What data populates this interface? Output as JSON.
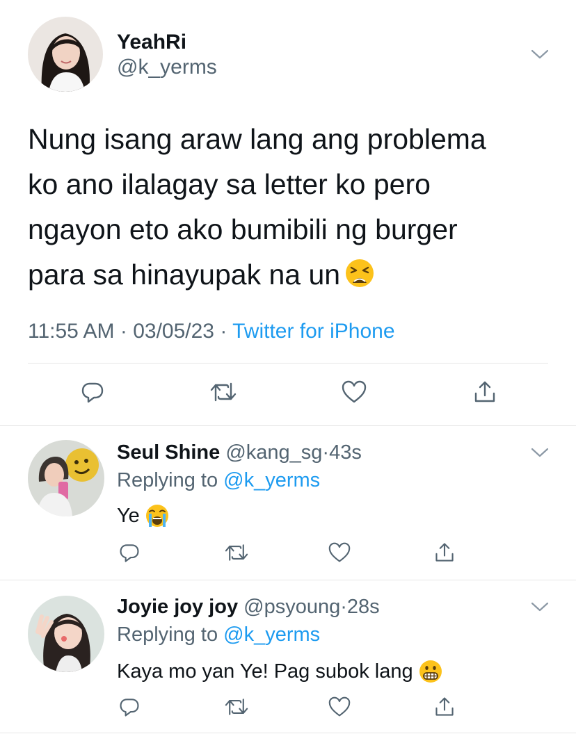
{
  "main_tweet": {
    "display_name": "YeahRi",
    "handle": "@k_yerms",
    "text_lines": [
      "Nung isang araw lang ang problema",
      "ko ano ilalagay sa letter ko pero",
      "ngayon eto ako bumibili ng burger",
      "para sa hinayupak na un"
    ],
    "emoji": "tired-face-emoji",
    "time": "11:55 AM",
    "separator": " · ",
    "date": "03/05/23",
    "source": "Twitter for iPhone",
    "actions": [
      "reply-icon",
      "retweet-icon",
      "like-icon",
      "share-icon"
    ]
  },
  "replies": [
    {
      "display_name": "Seul Shine",
      "handle": "@kang_sg",
      "time": "43s",
      "replying_prefix": "Replying to ",
      "replying_to": "@k_yerms",
      "text": "Ye",
      "emoji": "loudly-crying-face-emoji"
    },
    {
      "display_name": "Joyie joy joy",
      "handle": "@psyoung",
      "time": "28s",
      "replying_prefix": "Replying to ",
      "replying_to": "@k_yerms",
      "text": "Kaya mo yan Ye! Pag subok lang",
      "emoji": "grimacing-face-emoji"
    }
  ],
  "colors": {
    "link": "#1d9bf0",
    "secondary_text": "#536471",
    "primary_text": "#0f1419",
    "divider": "#e6e6e6"
  }
}
